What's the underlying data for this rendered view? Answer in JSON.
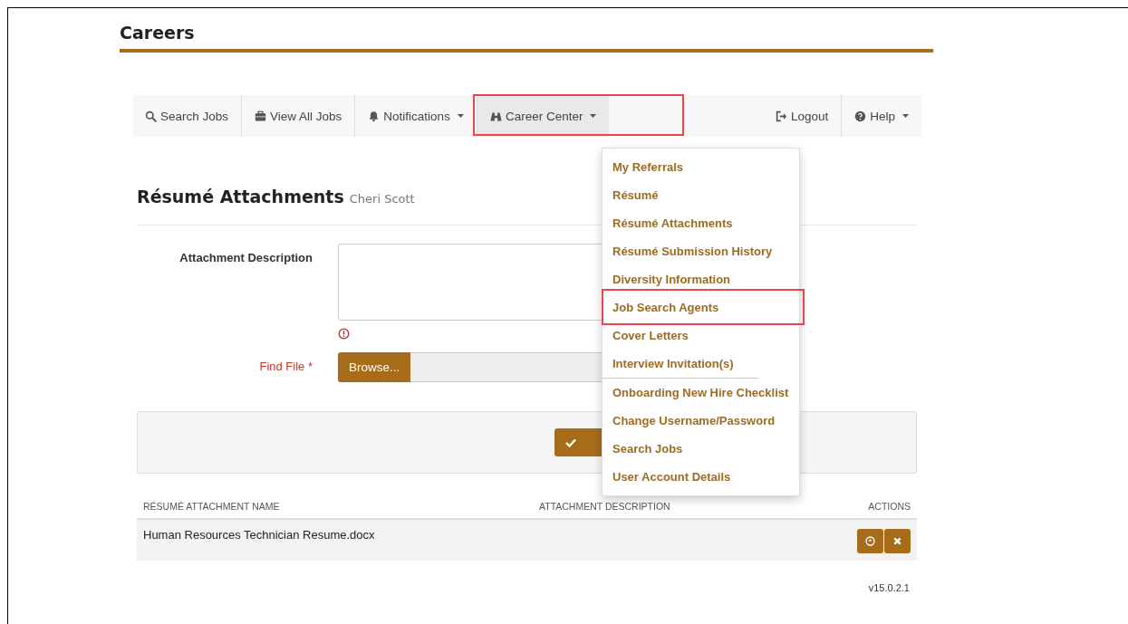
{
  "header": {
    "title": "Careers"
  },
  "nav": {
    "left": [
      {
        "label": "Search Jobs",
        "dropdown": false,
        "selected": false,
        "highlighted": false
      },
      {
        "label": "View All Jobs",
        "dropdown": false,
        "selected": false,
        "highlighted": false
      },
      {
        "label": "Notifications",
        "dropdown": true,
        "selected": false,
        "highlighted": false
      },
      {
        "label": "Career Center",
        "dropdown": true,
        "selected": true,
        "highlighted": true
      }
    ],
    "right": [
      {
        "label": "Logout",
        "dropdown": false,
        "selected": false,
        "highlighted": false
      },
      {
        "label": "Help",
        "dropdown": true,
        "selected": false,
        "highlighted": false
      }
    ]
  },
  "menu": {
    "groups": [
      [
        {
          "label": "My Referrals",
          "highlighted": false
        },
        {
          "label": "Résumé",
          "highlighted": false
        },
        {
          "label": "Résumé Attachments",
          "highlighted": false
        },
        {
          "label": "Résumé Submission History",
          "highlighted": false
        },
        {
          "label": "Diversity Information",
          "highlighted": false
        },
        {
          "label": "Job Search Agents",
          "highlighted": true
        },
        {
          "label": "Cover Letters",
          "highlighted": false
        },
        {
          "label": "Interview Invitation(s)",
          "highlighted": false
        }
      ],
      [
        {
          "label": "Onboarding New Hire Checklist",
          "highlighted": false
        },
        {
          "label": "Change Username/Password",
          "highlighted": false
        },
        {
          "label": "Search Jobs",
          "highlighted": false
        },
        {
          "label": "User Account Details",
          "highlighted": false
        }
      ]
    ]
  },
  "page": {
    "title": "Résumé Attachments",
    "subtitle": "Cheri Scott"
  },
  "form": {
    "description_label": "Attachment Description",
    "description_error": true,
    "file_label": "Find File *",
    "file_required": true,
    "browse_button": "Browse..."
  },
  "table": {
    "columns": [
      "RÉSUMÉ ATTACHMENT NAME",
      "ATTACHMENT DESCRIPTION",
      "ACTIONS"
    ],
    "rows": [
      {
        "name": "Human Resources Technician Resume.docx"
      }
    ]
  },
  "footer": {
    "version": "v15.0.2.1"
  }
}
